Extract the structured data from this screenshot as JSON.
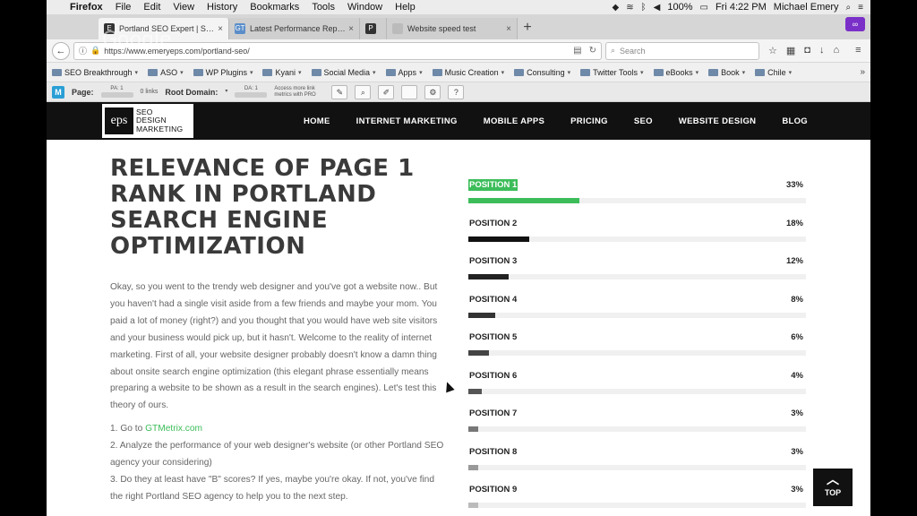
{
  "menubar": {
    "app": "Firefox",
    "menus": [
      "File",
      "Edit",
      "View",
      "History",
      "Bookmarks",
      "Tools",
      "Window",
      "Help"
    ],
    "battery": "100%",
    "time": "Fri 4:22 PM",
    "user": "Michael Emery"
  },
  "tabs": [
    {
      "label": "Portland SEO Expert | Sear...",
      "icon": "E",
      "icon_color": "#333333",
      "active": true
    },
    {
      "label": "Latest Performance Report ...",
      "icon": "GT",
      "icon_color": "#5b8ec9",
      "active": false
    },
    {
      "label": "",
      "icon": "P",
      "icon_color": "#333333",
      "active": false
    },
    {
      "label": "Website speed test",
      "icon": "",
      "icon_color": "#bbbbbb",
      "active": false
    }
  ],
  "url": "https://www.emeryeps.com/portland-seo/",
  "search_placeholder": "Search",
  "watermark": "Google",
  "bookmarks": [
    {
      "label": "SEO Breakthrough",
      "caret": true
    },
    {
      "label": "ASO",
      "caret": true
    },
    {
      "label": "WP Plugins",
      "caret": true
    },
    {
      "label": "Kyani",
      "caret": true
    },
    {
      "label": "Social Media",
      "caret": true
    },
    {
      "label": "Apps",
      "caret": true
    },
    {
      "label": "Music Creation",
      "caret": true
    },
    {
      "label": "Consulting",
      "caret": true
    },
    {
      "label": "Twitter Tools",
      "caret": true
    },
    {
      "label": "eBooks",
      "caret": true
    },
    {
      "label": "Book",
      "caret": true
    },
    {
      "label": "Chile",
      "caret": true
    }
  ],
  "mozbar": {
    "logo": "M",
    "page_label": "Page:",
    "pa": "PA: 1",
    "links": "0 links",
    "root_label": "Root Domain:",
    "da": "DA: 1",
    "more": "Access more link metrics with PRO"
  },
  "site": {
    "logo_mark": "eps",
    "logo_text": [
      "SEO",
      "DESIGN",
      "MARKETING"
    ],
    "nav": [
      "HOME",
      "INTERNET MARKETING",
      "MOBILE APPS",
      "PRICING",
      "SEO",
      "WEBSITE DESIGN",
      "BLOG"
    ],
    "title": "RELEVANCE OF PAGE 1 RANK IN PORTLAND SEARCH ENGINE OPTIMIZATION",
    "body": "Okay, so you went to the trendy web designer and you've got a website now.. But you haven't had a single visit aside from a few friends and maybe your mom. You paid a lot of money (right?) and you thought that you would have web site visitors and your business would pick up, but it hasn't. Welcome to the reality of internet marketing. First of all, your website designer probably doesn't know a damn thing about onsite search engine optimization (this elegant phrase essentially means preparing a website to be shown as a result in the search engines). Let's test this theory of ours.",
    "step1_prefix": "1. Go to ",
    "step1_link": "GTMetrix.com",
    "step2": "2. Analyze the performance of your web designer's website (or other Portland SEO agency your considering)",
    "step3": "3. Do they at least have \"B\" scores? If yes, maybe you're okay. If not, you've find the right Portland SEO agency to help you to the next step.",
    "top_label": "TOP"
  },
  "positions": [
    {
      "label": "POSITION 1",
      "percent": "33%",
      "value": 33,
      "color": "#3cbd5a",
      "highlight": true
    },
    {
      "label": "POSITION 2",
      "percent": "18%",
      "value": 18,
      "color": "#111111",
      "highlight": false
    },
    {
      "label": "POSITION 3",
      "percent": "12%",
      "value": 12,
      "color": "#222222",
      "highlight": false
    },
    {
      "label": "POSITION 4",
      "percent": "8%",
      "value": 8,
      "color": "#333333",
      "highlight": false
    },
    {
      "label": "POSITION 5",
      "percent": "6%",
      "value": 6,
      "color": "#444444",
      "highlight": false
    },
    {
      "label": "POSITION 6",
      "percent": "4%",
      "value": 4,
      "color": "#555555",
      "highlight": false
    },
    {
      "label": "POSITION 7",
      "percent": "3%",
      "value": 3,
      "color": "#777777",
      "highlight": false
    },
    {
      "label": "POSITION 8",
      "percent": "3%",
      "value": 3,
      "color": "#999999",
      "highlight": false
    },
    {
      "label": "POSITION 9",
      "percent": "3%",
      "value": 3,
      "color": "#bbbbbb",
      "highlight": false
    }
  ]
}
